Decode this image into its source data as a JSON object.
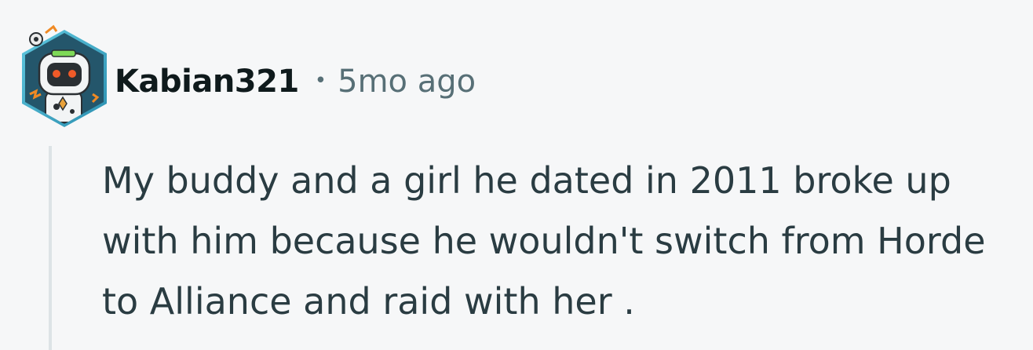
{
  "comment": {
    "author": "Kabian321",
    "separator": "•",
    "timestamp": "5mo ago",
    "body": "My buddy and a girl he dated in 2011 broke up with him because he wouldn't switch from Horde to Alliance and raid with her .",
    "avatar_icon": "robot-avatar-icon"
  },
  "colors": {
    "background": "#f6f7f8",
    "username": "#0f1a1c",
    "meta": "#576f76",
    "body": "#2a3c42",
    "thread_line": "#dde3e6",
    "avatar_frame": "#3ea8c4"
  }
}
